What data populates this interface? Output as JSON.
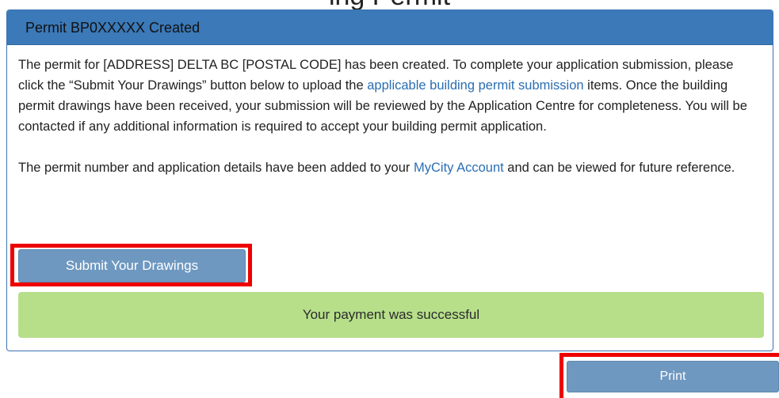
{
  "cropped_heading": "ing    Permit",
  "panel": {
    "title": "Permit BP0XXXXX Created",
    "para1": {
      "text_before_link": "The permit for [ADDRESS] DELTA BC [POSTAL CODE] has been created. To complete your application submission, please click the “Submit Your Drawings” button below to upload the ",
      "link_text": "applicable building permit submission",
      "text_after_link": " items. Once the building permit drawings have been received, your submission will be reviewed by the Application Centre for completeness. You will be contacted if any additional information is required to accept your building permit application."
    },
    "para2": {
      "text_before_link": "The permit number and application details have been added to your ",
      "link_text": "MyCity Account",
      "text_after_link": " and can be viewed for future reference."
    },
    "submit_button_label": "Submit Your Drawings",
    "success_message": "Your payment was successful"
  },
  "print_button_label": "Print",
  "colors": {
    "header_bg": "#3b79b8",
    "button_bg": "#6e98c0",
    "success_bg": "#b7df8a",
    "highlight_border": "#ee0000",
    "link": "#2a6eb3"
  }
}
